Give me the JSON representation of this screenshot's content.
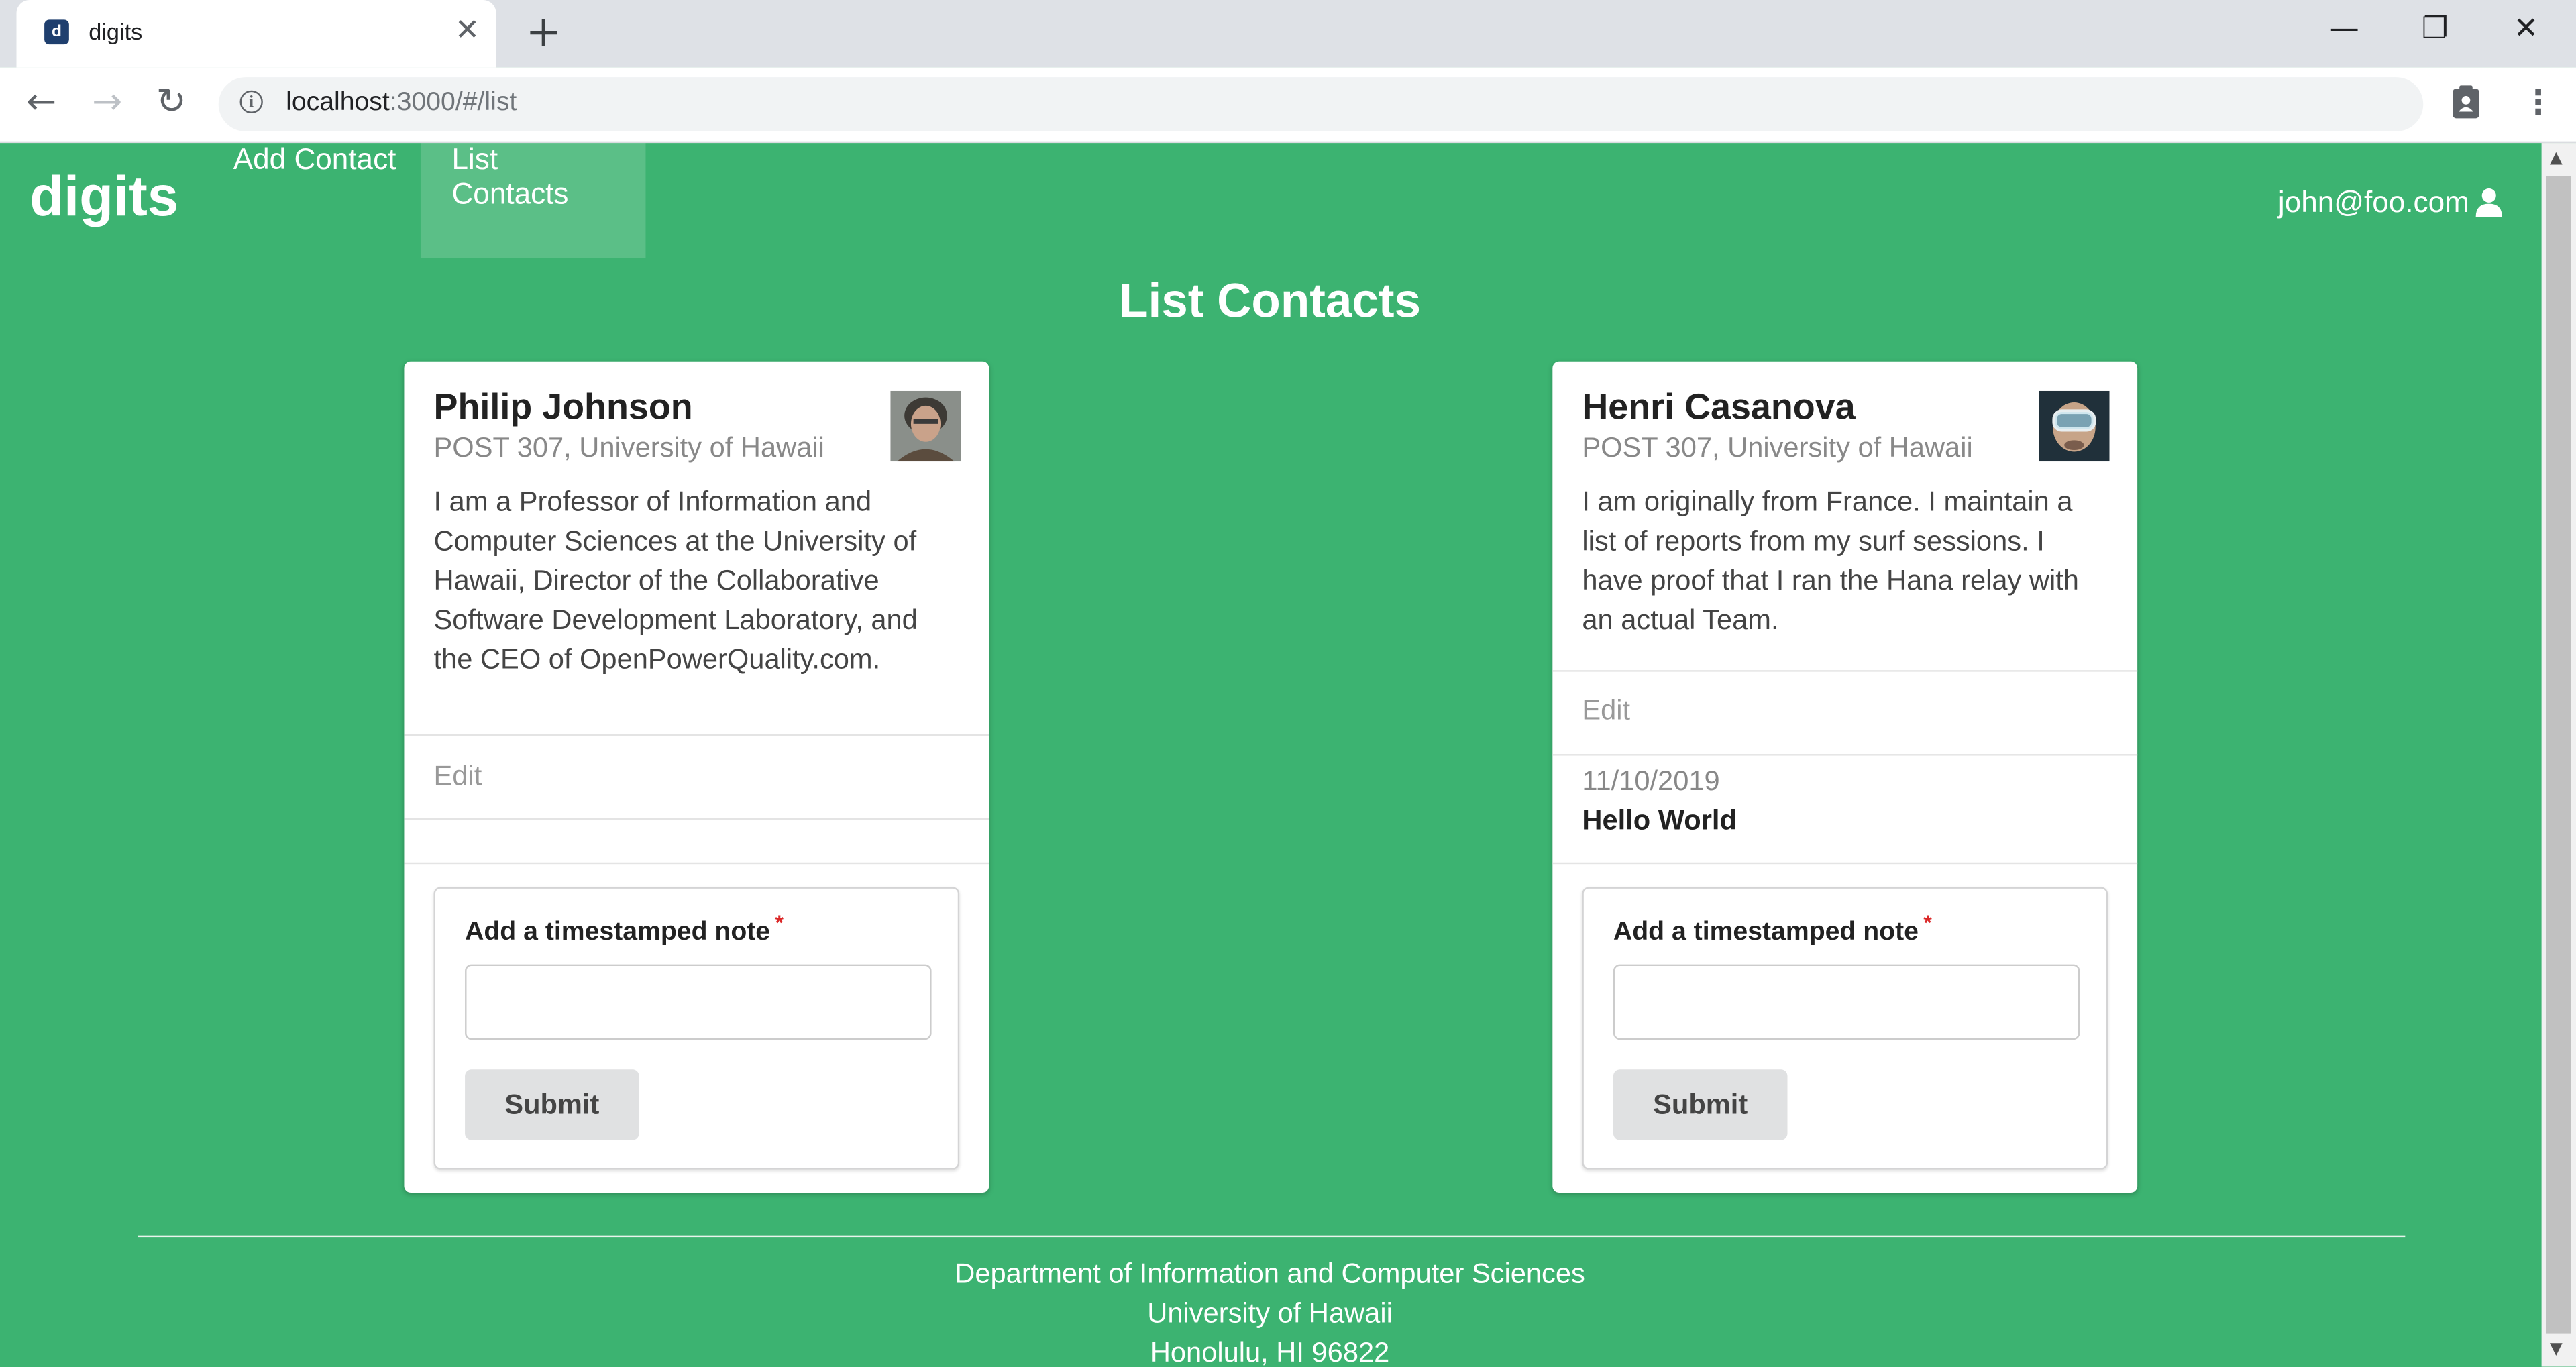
{
  "browser": {
    "tab_title": "digits",
    "new_tab": "+",
    "close_tab": "✕",
    "url_host": "localhost",
    "url_path": ":3000/#/list",
    "window_controls": [
      "—",
      "❐",
      "✕"
    ]
  },
  "app": {
    "brand": "digits",
    "nav": [
      {
        "label": "Add Contact"
      },
      {
        "label": "List Contacts",
        "active": true
      }
    ],
    "user_email": "john@foo.com"
  },
  "page": {
    "title": "List Contacts"
  },
  "contacts": [
    {
      "name": "Philip Johnson",
      "address": "POST 307, University of Hawaii",
      "description": "I am a Professor of Information and Computer Sciences at the University of Hawaii, Director of the Collaborative Software Development Laboratory, and the CEO of OpenPowerQuality.com.",
      "edit_label": "Edit",
      "notes": [],
      "form": {
        "label": "Add a timestamped note",
        "required_mark": "*",
        "input_value": "",
        "submit_label": "Submit"
      }
    },
    {
      "name": "Henri Casanova",
      "address": "POST 307, University of Hawaii",
      "description": "I am originally from France. I maintain a list of reports from my surf sessions. I have proof that I ran the Hana relay with an actual Team.",
      "edit_label": "Edit",
      "notes": [
        {
          "date": "11/10/2019",
          "text": "Hello World"
        }
      ],
      "form": {
        "label": "Add a timestamped note",
        "required_mark": "*",
        "input_value": "",
        "submit_label": "Submit"
      }
    }
  ],
  "footer": {
    "lines": [
      "Department of Information and Computer Sciences",
      "University of Hawaii",
      "Honolulu, HI 96822"
    ]
  },
  "colors": {
    "page_bg": "#3cb371",
    "accent": "#3cb371"
  }
}
